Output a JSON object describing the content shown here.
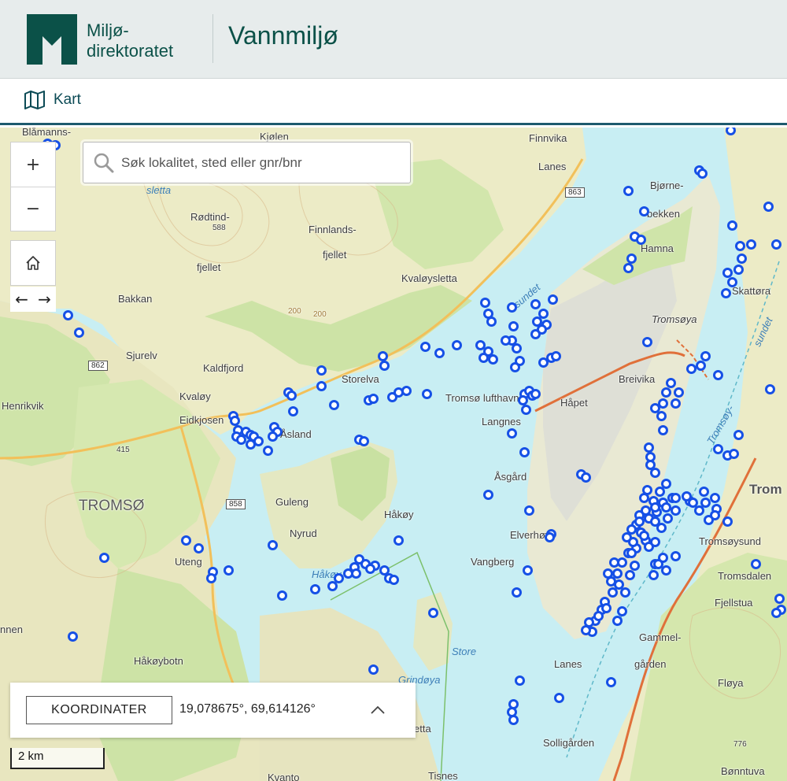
{
  "header": {
    "org_line1": "Miljø-",
    "org_line2": "direktoratet",
    "app_title": "Vannmiljø",
    "brand_color": "#0b5148"
  },
  "nav": {
    "map_tab_label": "Kart",
    "icon": "map-icon"
  },
  "search": {
    "placeholder": "Søk lokalitet, sted eller gnr/bnr",
    "icon": "search-icon"
  },
  "map_controls": {
    "zoom_in": "+",
    "zoom_out": "−",
    "back": "←",
    "forward": "→",
    "home_icon": "home-icon"
  },
  "coordinates": {
    "button_label": "KOORDINATER",
    "value": "19,078675°, 69,614126°",
    "toggle_icon": "chevron-up-icon"
  },
  "scale": {
    "label": "2 km"
  },
  "road_numbers": [
    "863",
    "862",
    "858"
  ],
  "place_names": {
    "kjolen": "Kjølen",
    "finnvika": "Finnvika",
    "lanes_n": "Lanes",
    "bjorne": "Bjørne-",
    "bekken": "bekken",
    "hamna": "Hamna",
    "skattora": "Skattøra",
    "tromsoya": "Tromsøya",
    "breivika": "Breivika",
    "blamanns": "Blåmanns-",
    "sletta_tl": "sletta",
    "rodtind": "Rødtind-",
    "rodtind_h": "588",
    "fjellet_l": "fjellet",
    "finnlands": "Finnlands-",
    "fjellet_r": "fjellet",
    "kvaloysletta": "Kvaløysletta",
    "bakkan": "Bakkan",
    "sjurelv": "Sjurelv",
    "kaldfjord": "Kaldfjord",
    "storelva": "Storelva",
    "kvaloy": "Kvaløy",
    "henrikvik": "Henrikvik",
    "eidkjosen": "Eidkjosen",
    "asland": "Åsland",
    "tromso_airport": "Tromsø lufthavn",
    "langnes": "Langnes",
    "hapet": "Håpet",
    "h415": "415",
    "tromso_big": "TROMSØ",
    "guleng": "Guleng",
    "nyrud": "Nyrud",
    "hakoy": "Håkøy",
    "asgard": "Åsgård",
    "elverhoy": "Elverhøy",
    "vangberg": "Vangberg",
    "utang": "Uteng",
    "hakoy_s": "Håkøy",
    "tromsoysund": "Tromsøysund",
    "tromsdalen": "Tromsdalen",
    "fjellstua": "Fjellstua",
    "gammel": "Gammel-",
    "garden": "gården",
    "hakoybotn": "Håkøybotn",
    "store": "Store",
    "grindoya": "Grindøya",
    "lanes_s": "Lanes",
    "floya": "Fløya",
    "solligarden": "Solligården",
    "h776": "776",
    "bonntuva": "Bønntuva",
    "etta": "etta",
    "tisnes": "Tisnes",
    "kvanto": "Kvanto",
    "nnen": "nnen",
    "trom_e": "Trom",
    "h200a": "200",
    "h200b": "200",
    "sundet_w": "sundet",
    "sundet_e": "sundet",
    "tromsoy_sund": "Tromsøy-"
  },
  "stations": {
    "color": "#1650e6",
    "count_visible": 300
  }
}
